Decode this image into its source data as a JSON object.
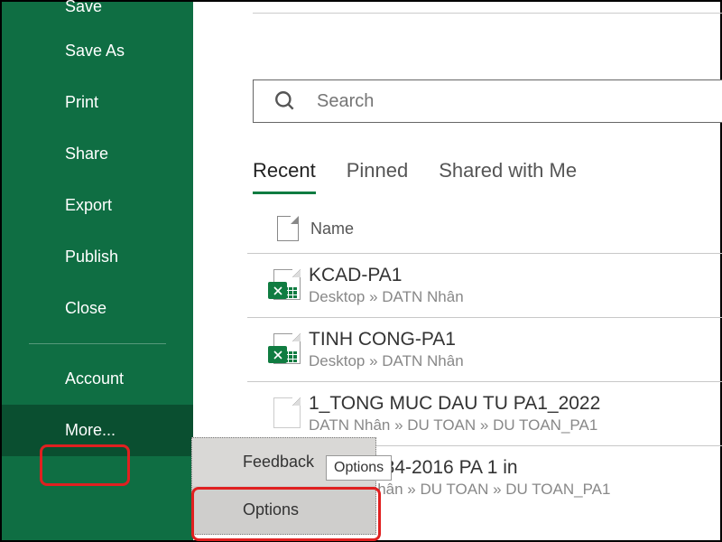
{
  "sidebar": {
    "items": [
      {
        "label": "Save"
      },
      {
        "label": "Save As"
      },
      {
        "label": "Print"
      },
      {
        "label": "Share"
      },
      {
        "label": "Export"
      },
      {
        "label": "Publish"
      },
      {
        "label": "Close"
      },
      {
        "label": "Account"
      },
      {
        "label": "More..."
      }
    ]
  },
  "submenu": {
    "items": [
      {
        "label": "Feedback"
      },
      {
        "label": "Options"
      }
    ],
    "tooltip": "Options"
  },
  "search": {
    "placeholder": "Search"
  },
  "tabs": [
    {
      "label": "Recent",
      "active": true
    },
    {
      "label": "Pinned"
    },
    {
      "label": "Shared with Me"
    }
  ],
  "columns": {
    "name": "Name"
  },
  "files": [
    {
      "name": "KCAD-PA1",
      "path": "Desktop » DATN Nhân"
    },
    {
      "name": "TINH CONG-PA1",
      "path": "Desktop » DATN Nhân"
    },
    {
      "name": "1_TONG MUC DAU TU PA1_2022",
      "path": "DATN Nhân » DU TOAN » DU TOAN_PA1"
    },
    {
      "name": "P GIA 3384-2016 PA 1 in",
      "path": "» DATN Nhân » DU TOAN » DU TOAN_PA1"
    }
  ]
}
